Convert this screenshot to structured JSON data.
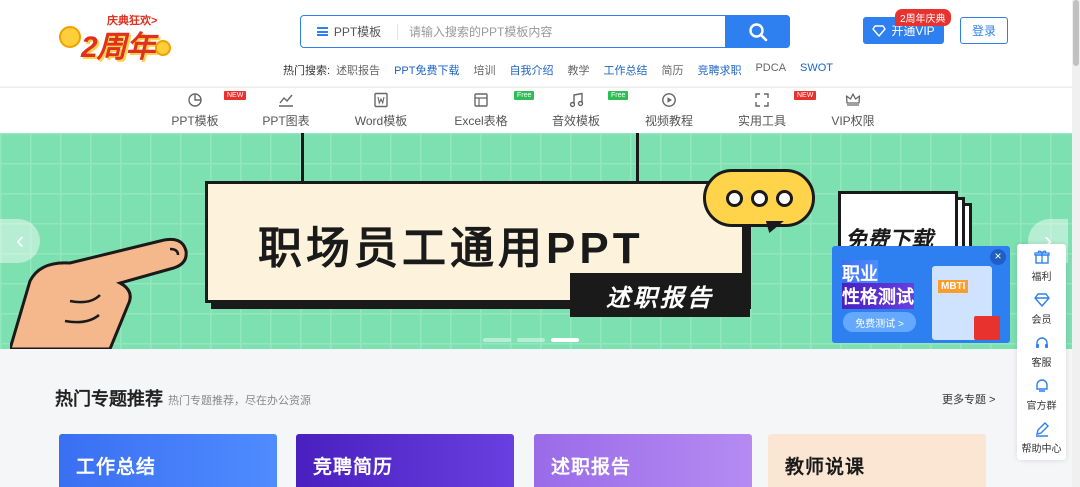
{
  "logo": {
    "tagline": "庆典狂欢>",
    "title": "2周年"
  },
  "search": {
    "category": "PPT模板",
    "placeholder": "请输入搜索的PPT模板内容"
  },
  "hot_search": {
    "label": "热门搜索:",
    "keywords": [
      {
        "text": "述职报告",
        "highlight": false
      },
      {
        "text": "PPT免费下载",
        "highlight": true
      },
      {
        "text": "培训",
        "highlight": false
      },
      {
        "text": "自我介绍",
        "highlight": true
      },
      {
        "text": "教学",
        "highlight": false
      },
      {
        "text": "工作总结",
        "highlight": true
      },
      {
        "text": "简历",
        "highlight": false
      },
      {
        "text": "竞聘求职",
        "highlight": true
      },
      {
        "text": "PDCA",
        "highlight": false
      },
      {
        "text": "SWOT",
        "highlight": true
      }
    ]
  },
  "header": {
    "vip_label": "开通VIP",
    "vip_badge": "2周年庆典",
    "login_label": "登录"
  },
  "categories": [
    {
      "label": "PPT模板",
      "icon": "pie-chart-icon",
      "badge": "NEW"
    },
    {
      "label": "PPT图表",
      "icon": "line-chart-icon",
      "badge": ""
    },
    {
      "label": "Word模板",
      "icon": "word-doc-icon",
      "badge": ""
    },
    {
      "label": "Excel表格",
      "icon": "excel-sheet-icon",
      "badge": "Free"
    },
    {
      "label": "音效模板",
      "icon": "music-note-icon",
      "badge": "Free"
    },
    {
      "label": "视频教程",
      "icon": "play-circle-icon",
      "badge": ""
    },
    {
      "label": "实用工具",
      "icon": "tool-icon",
      "badge": "NEW"
    },
    {
      "label": "VIP权限",
      "icon": "crown-icon",
      "badge": ""
    }
  ],
  "banner": {
    "headline": "职场员工通用PPT",
    "tag": "述职报告",
    "side_text": "免费下载",
    "slide_count": 3,
    "active_slide": 2
  },
  "mbti_popup": {
    "line1": "职业",
    "line2": "性格测试",
    "cta": "免费测试 >",
    "card_label": "MBTI",
    "close": "×"
  },
  "sidebar": [
    {
      "label": "福利",
      "icon": "gift-icon"
    },
    {
      "label": "会员",
      "icon": "diamond-icon"
    },
    {
      "label": "客服",
      "icon": "headset-icon"
    },
    {
      "label": "官方群",
      "icon": "chat-group-icon"
    },
    {
      "label": "帮助中心",
      "icon": "edit-pencil-icon"
    }
  ],
  "section": {
    "title": "热门专题推荐",
    "subtitle": "热门专题推荐，尽在办公资源",
    "more": "更多专题 >",
    "topics": [
      {
        "name": "工作总结"
      },
      {
        "name": "竞聘简历"
      },
      {
        "name": "述职报告"
      },
      {
        "name": "教师说课"
      }
    ]
  },
  "colors": {
    "primary": "#2e7ff0",
    "banner_bg": "#7de0b0",
    "accent_red": "#e8322d",
    "free_green": "#2fbd55"
  }
}
